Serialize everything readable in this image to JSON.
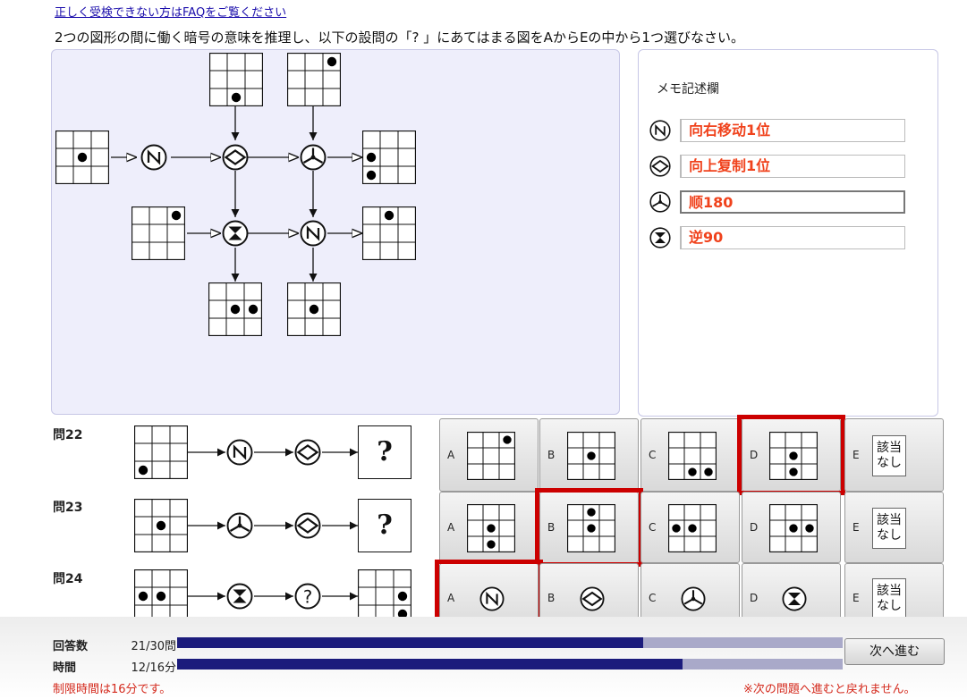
{
  "header": {
    "faq_link": "正しく受検できない方はFAQをご覧ください",
    "instruction": "2つの図形の間に働く暗号の意味を推理し、以下の設問の「? 」にあてはまる図をAからEの中から1つ選びなさい。"
  },
  "memo": {
    "title": "メモ記述欄",
    "entries": [
      {
        "symbol": "n-symbol-icon",
        "text": "向右移动1位"
      },
      {
        "symbol": "diamond-symbol-icon",
        "text": "向上复制1位"
      },
      {
        "symbol": "y-symbol-icon",
        "text": "顺180"
      },
      {
        "symbol": "hourglass-symbol-icon",
        "text": "逆90"
      }
    ]
  },
  "questions": [
    {
      "label": "問22",
      "unknown": "?",
      "options": [
        {
          "letter": "A"
        },
        {
          "letter": "B"
        },
        {
          "letter": "C"
        },
        {
          "letter": "D"
        },
        {
          "letter": "E",
          "text": "該当なし"
        }
      ],
      "selected": "D"
    },
    {
      "label": "問23",
      "unknown": "?",
      "options": [
        {
          "letter": "A"
        },
        {
          "letter": "B"
        },
        {
          "letter": "C"
        },
        {
          "letter": "D"
        },
        {
          "letter": "E",
          "text": "該当なし"
        }
      ],
      "selected": "B"
    },
    {
      "label": "問24",
      "unknown": "?",
      "options": [
        {
          "letter": "A",
          "icon": "n-symbol-icon"
        },
        {
          "letter": "B",
          "icon": "diamond-symbol-icon"
        },
        {
          "letter": "C",
          "icon": "y-symbol-icon"
        },
        {
          "letter": "D",
          "icon": "hourglass-symbol-icon"
        },
        {
          "letter": "E",
          "text": "該当なし"
        }
      ],
      "selected": "A"
    }
  ],
  "status": {
    "answered_label": "回答数",
    "answered_value": "21/30問",
    "answered_progress": 0.7,
    "time_label": "時間",
    "time_value": "12/16分",
    "time_progress": 0.76,
    "next_button": "次へ進む",
    "limit_note": "制限時間は16分です。",
    "warning_note": "※次の問題へ進むと戻れません。"
  },
  "colors": {
    "panel_bg": "#eeeefb",
    "memo_text": "#f0421c",
    "selection": "#cc0000",
    "bar_fill": "#1c1c7c",
    "bar_track": "#a9a9c9",
    "warning": "#d42a1d"
  }
}
